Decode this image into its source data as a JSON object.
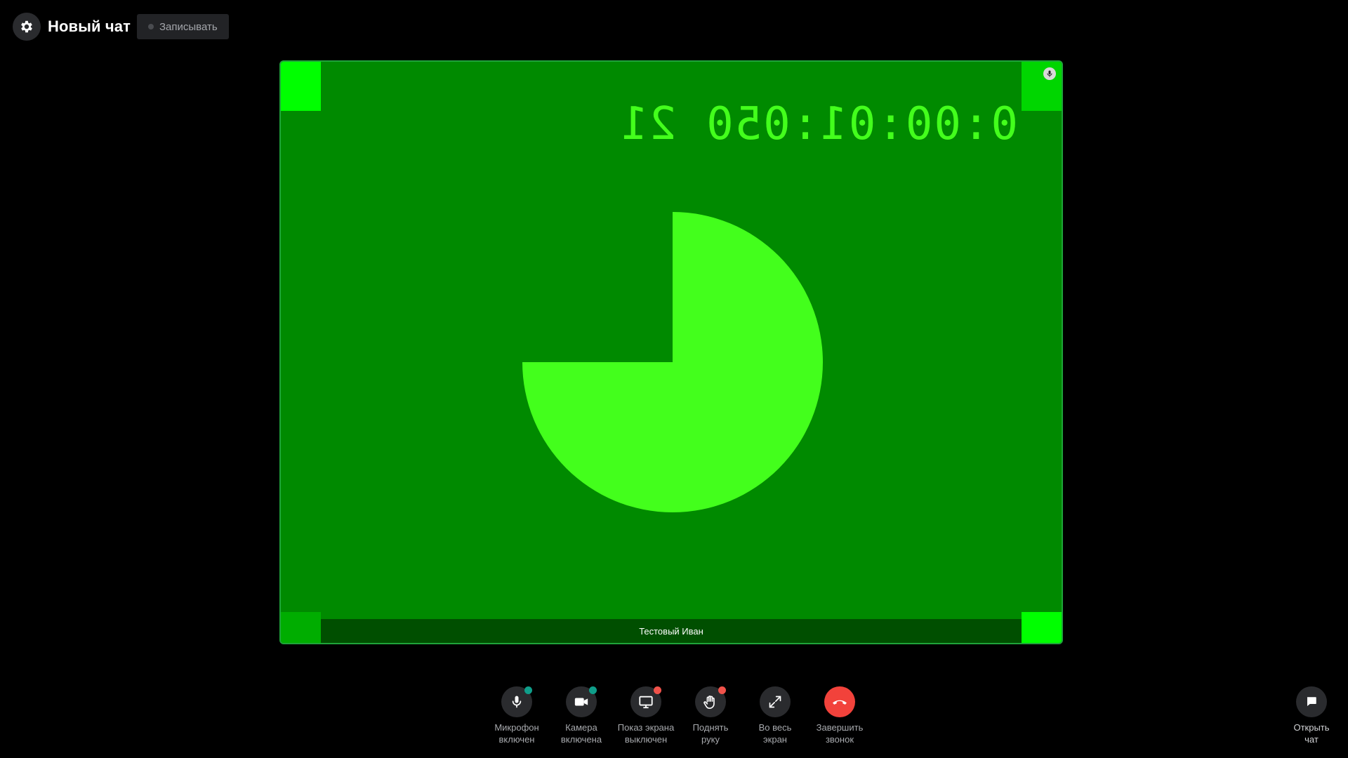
{
  "header": {
    "title": "Новый чат",
    "record_label": "Записывать"
  },
  "video": {
    "participant_name": "Тестовый Иван",
    "timer_text": "0:00:01:050 21",
    "pie_fraction_filled": 0.75,
    "colors": {
      "background": "#008a00",
      "foreground": "#43ff1c",
      "name_bar": "#004f00",
      "border": "#1fa43a"
    }
  },
  "toolbar": {
    "items": [
      {
        "id": "mic",
        "label": "Микрофон\nвключен",
        "icon": "microphone-icon",
        "badge": "#0f9e8a"
      },
      {
        "id": "camera",
        "label": "Камера\nвключена",
        "icon": "camera-icon",
        "badge": "#0f9e8a"
      },
      {
        "id": "screen",
        "label": "Показ экрана\nвыключен",
        "icon": "monitor-icon",
        "badge": "#f0524a"
      },
      {
        "id": "hand",
        "label": "Поднять\nруку",
        "icon": "hand-icon",
        "badge": "#f0524a"
      },
      {
        "id": "fullscreen",
        "label": "Во весь\nэкран",
        "icon": "expand-icon",
        "badge": null
      },
      {
        "id": "end",
        "label": "Завершить\nзвонок",
        "icon": "phone-hangup-icon",
        "badge": null
      }
    ],
    "open_chat_label": "Открыть\nчат"
  }
}
